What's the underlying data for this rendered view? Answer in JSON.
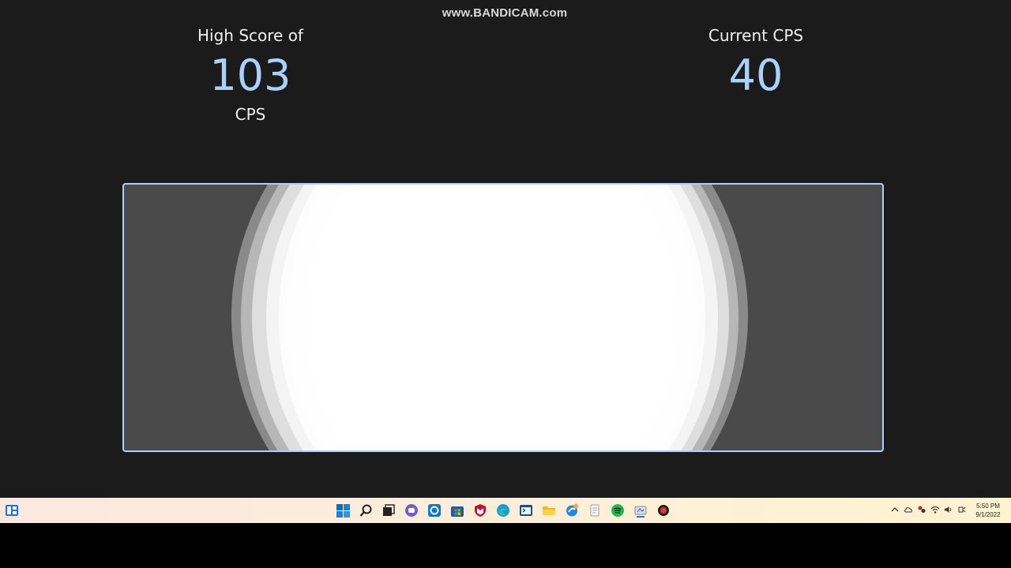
{
  "watermark": "www.BANDICAM.com",
  "high_score": {
    "label": "High Score of",
    "value": "103",
    "unit": "CPS"
  },
  "current": {
    "label": "Current CPS",
    "value": "40"
  },
  "colors": {
    "accent": "#a9d1fb",
    "background": "#1b1b1b",
    "click_area": "#4a4a4a"
  },
  "taskbar": {
    "widget_icon": "widgets-icon",
    "pinned": [
      "windows-start-icon",
      "search-icon",
      "task-view-icon",
      "chat-icon",
      "app-icon",
      "store-icon",
      "mcafee-icon",
      "edge-icon",
      "terminal-icon",
      "file-explorer-icon",
      "browser-icon",
      "notepad-icon",
      "spotify-icon",
      "app-window-icon",
      "record-icon"
    ],
    "tray": [
      "chevron-up-icon",
      "cloud-icon",
      "network-icon",
      "wifi-icon",
      "volume-icon",
      "battery-icon"
    ],
    "time": "5:50 PM",
    "date": "9/1/2022"
  }
}
